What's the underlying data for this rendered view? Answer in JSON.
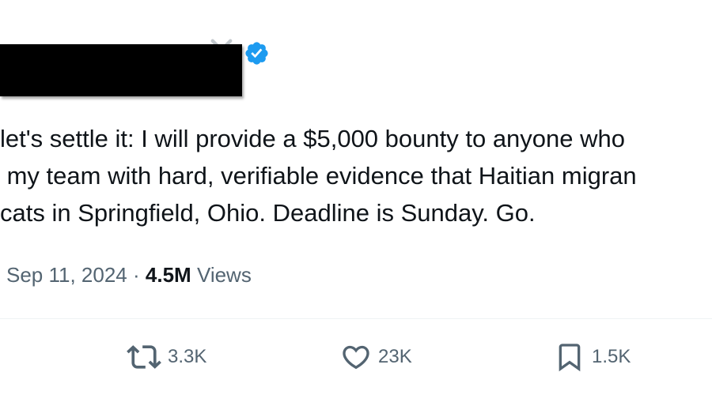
{
  "author": {
    "name_visible": "",
    "redacted": true,
    "verified_badge_color": "#1d9bf0"
  },
  "tweet": {
    "lines": [
      "let's settle it: I will provide a $5,000 bounty to anyone who",
      " my team with hard, verifiable evidence that Haitian migran",
      "cats in Springfield, Ohio. Deadline is Sunday. Go."
    ]
  },
  "meta": {
    "date": "Sep 11, 2024",
    "separator": "·",
    "views_count": "4.5M",
    "views_label": "Views"
  },
  "actions": {
    "retweets": "3.3K",
    "likes": "23K",
    "bookmarks": "1.5K"
  },
  "colors": {
    "text": "#0f1419",
    "secondary": "#536471",
    "divider": "#eff3f4",
    "accent": "#1d9bf0"
  }
}
